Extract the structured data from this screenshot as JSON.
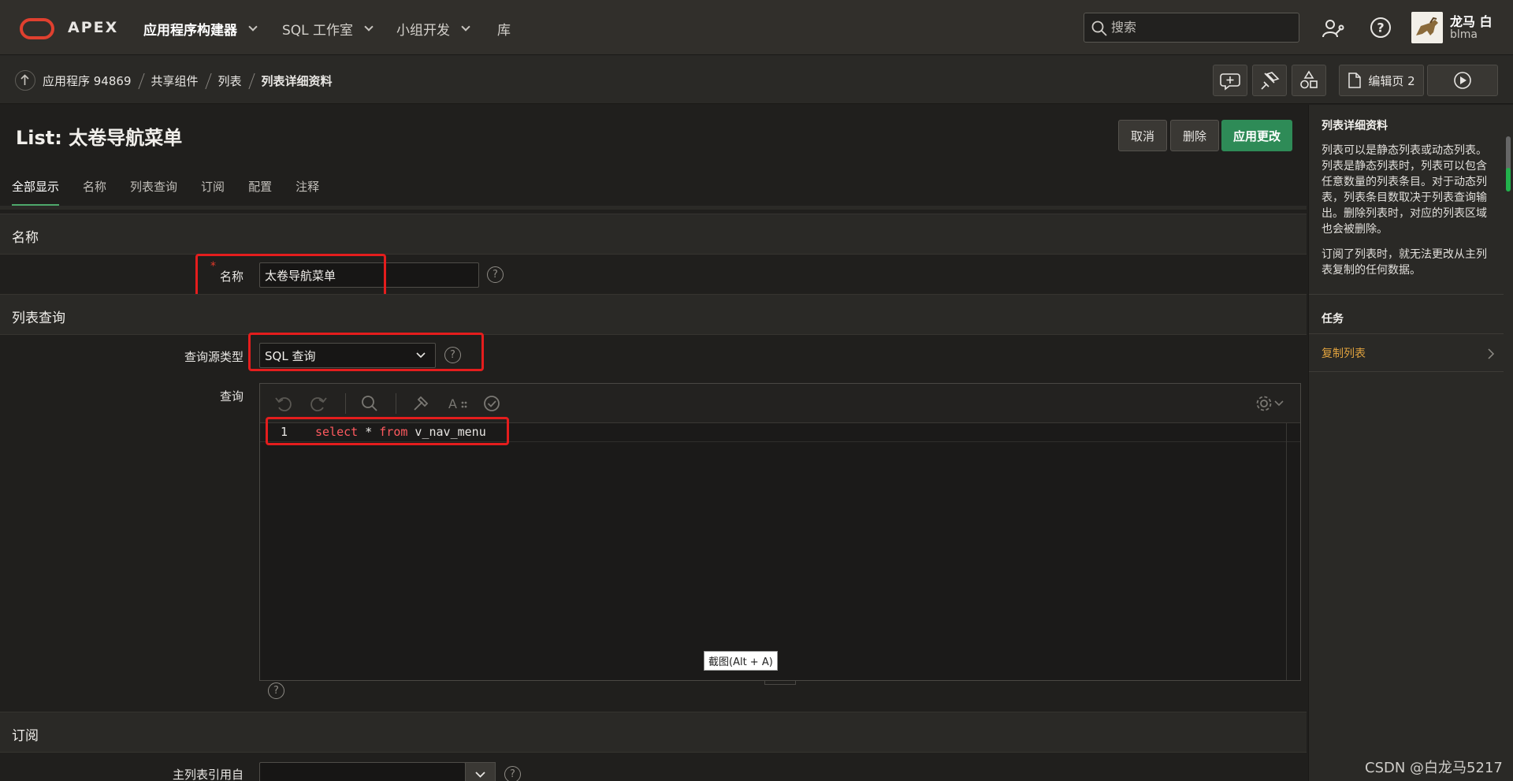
{
  "brand": {
    "name": "APEX"
  },
  "topnav": [
    {
      "label": "应用程序构建器",
      "active": true,
      "dropdown": true
    },
    {
      "label": "SQL 工作室",
      "active": false,
      "dropdown": true
    },
    {
      "label": "小组开发",
      "active": false,
      "dropdown": true
    },
    {
      "label": "库",
      "active": false,
      "dropdown": false
    }
  ],
  "search": {
    "placeholder": "搜索"
  },
  "user": {
    "name": "龙马 白",
    "id": "blma"
  },
  "breadcrumb": [
    "应用程序 94869",
    "共享组件",
    "列表",
    "列表详细资料"
  ],
  "toolbar": {
    "edit_page_label": "编辑页 2"
  },
  "page": {
    "title": "List: 太卷导航菜单",
    "cancel_label": "取消",
    "delete_label": "删除",
    "apply_label": "应用更改"
  },
  "tabs": [
    "全部显示",
    "名称",
    "列表查询",
    "订阅",
    "配置",
    "注释"
  ],
  "sections": {
    "name": {
      "heading": "名称",
      "field_label": "名称",
      "field_value": "太卷导航菜单"
    },
    "list_query": {
      "heading": "列表查询",
      "source_type_label": "查询源类型",
      "source_type_value": "SQL 查询",
      "query_label": "查询",
      "code": {
        "line_number": "1",
        "keyword_select": "select",
        "star": " * ",
        "keyword_from": "from",
        "table": " v_nav_menu"
      }
    },
    "subscription": {
      "heading": "订阅",
      "master_label": "主列表引用自",
      "master_value": ""
    }
  },
  "tooltip": "截图(Alt + A)",
  "sidebar": {
    "title": "列表详细资料",
    "paragraph1": "列表可以是静态列表或动态列表。列表是静态列表时，列表可以包含任意数量的列表条目。对于动态列表，列表条目数取决于列表查询输出。删除列表时，对应的列表区域也会被删除。",
    "paragraph2": "订阅了列表时，就无法更改从主列表复制的任何数据。",
    "tasks_title": "任务",
    "task_copy": "复制列表"
  },
  "watermark": "CSDN @白龙马5217",
  "colors": {
    "accent_green": "#2e8b57",
    "highlight_red": "#e41d1d",
    "link_orange": "#e0a23e",
    "keyword_red": "#ff5a5f"
  }
}
